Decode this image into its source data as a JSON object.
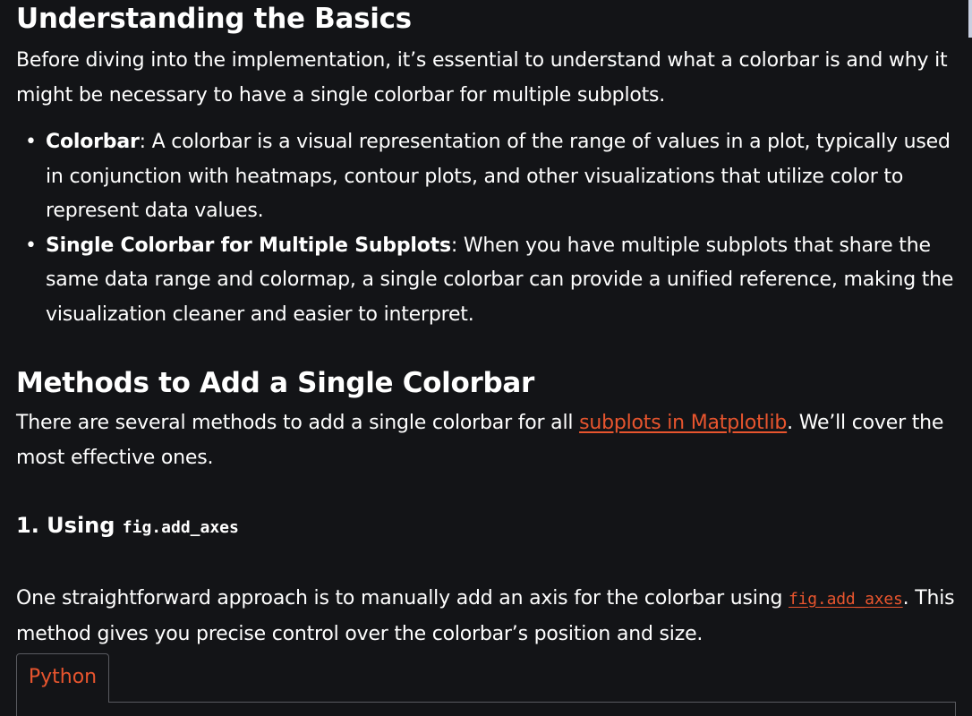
{
  "section1": {
    "heading": "Understanding the Basics",
    "intro": "Before diving into the implementation, it’s essential to understand what a colorbar is and why it might be necessary to have a single colorbar for multiple subplots.",
    "bullets": [
      {
        "term": "Colorbar",
        "text": ": A colorbar is a visual representation of the range of values in a plot, typically used in conjunction with heatmaps, contour plots, and other visualizations that utilize color to represent data values."
      },
      {
        "term": "Single Colorbar for Multiple Subplots",
        "text": ": When you have multiple subplots that share the same data range and colormap, a single colorbar can provide a unified reference, making the visualization cleaner and easier to interpret."
      }
    ]
  },
  "section2": {
    "heading": "Methods to Add a Single Colorbar",
    "intro_before": "There are several methods to add a single colorbar for all ",
    "intro_link": "subplots in Matplotlib",
    "intro_after": ". We’ll cover the most effective ones."
  },
  "method1": {
    "heading_prefix": "1. Using ",
    "heading_code": "fig.add_axes",
    "para_before": "One straightforward approach is to manually add an axis for the colorbar using ",
    "para_code": "fig.add_axes",
    "para_after": ". This method gives you precise control over the colorbar’s position and size."
  },
  "code_tab": {
    "label": "Python"
  },
  "colors": {
    "background": "#131417",
    "text": "#ffffff",
    "accent": "#e8552e",
    "border": "#5a5b60"
  }
}
